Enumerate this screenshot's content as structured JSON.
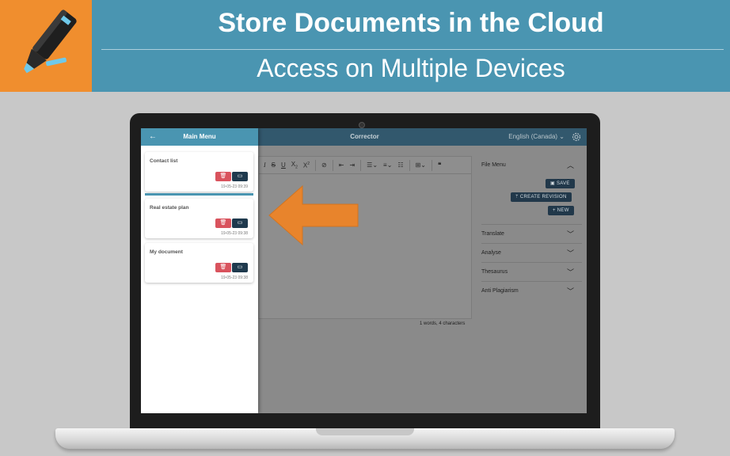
{
  "banner": {
    "headline1": "Store Documents in the Cloud",
    "headline2": "Access on Multiple Devices",
    "logo_icon": "highlighter-marker-icon",
    "colors": {
      "banner": "#4a95b1",
      "logo_bg": "#f08e2e"
    }
  },
  "app": {
    "title": "Corrector",
    "language": "English (Canada)",
    "settings_icon": "gear-icon"
  },
  "sidebar": {
    "title": "Main Menu",
    "back_icon": "arrow-left-icon",
    "documents": [
      {
        "name": "Contact list",
        "date": "19-05-23 09:39",
        "active": true
      },
      {
        "name": "Real estate plan",
        "date": "19-05-23 09:38",
        "active": false
      },
      {
        "name": "My document",
        "date": "19-05-23 09:38",
        "active": false
      }
    ],
    "delete_icon": "trash-icon",
    "open_icon": "folder-icon"
  },
  "editor": {
    "toolbar_icons": [
      "italic-icon",
      "strikethrough-icon",
      "underline-icon",
      "subscript-icon",
      "superscript-icon",
      "link-icon",
      "outdent-icon",
      "indent-icon",
      "bulleted-list-icon",
      "numbered-list-icon",
      "todo-list-icon",
      "table-icon",
      "blockquote-icon"
    ],
    "word_count": "1 words, 4 characters"
  },
  "file_menu": {
    "label": "File Menu",
    "save": "SAVE",
    "create_revision": "CREATE REVISION",
    "new": "+ NEW",
    "items": [
      "Translate",
      "Analyse",
      "Thesaurus",
      "Anti Plagiarism"
    ]
  }
}
